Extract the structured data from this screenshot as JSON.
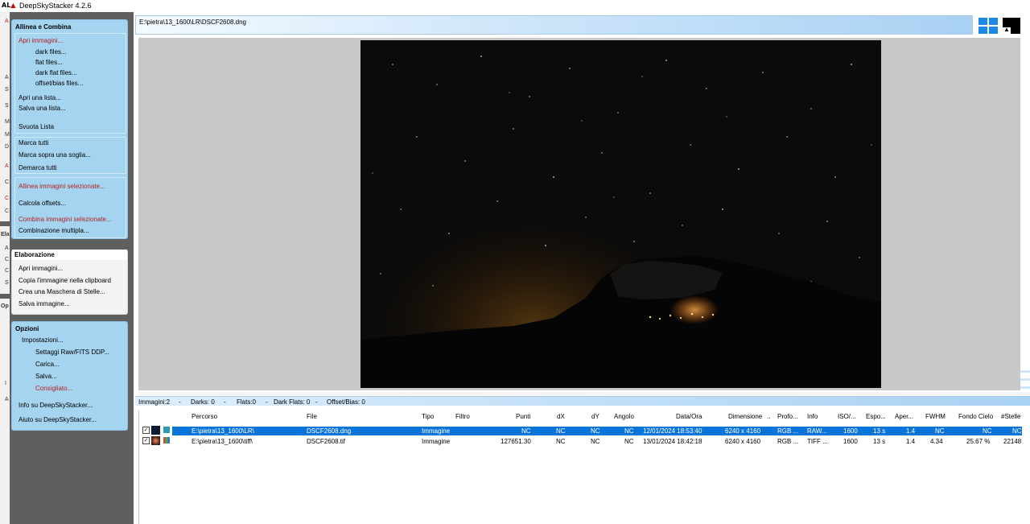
{
  "window": {
    "title": "DeepSkyStacker 4.2.6",
    "icon_text": "AL"
  },
  "left_strip": {
    "letters": [
      "A",
      "S",
      "A",
      "S",
      "S",
      "M",
      "M",
      "D",
      "A",
      "C",
      "C",
      "C",
      "Ela",
      "A",
      "C",
      "C",
      "S",
      "Op",
      "I",
      "A"
    ]
  },
  "panels": {
    "allinea": {
      "title": "Allinea e Combina",
      "group1": [
        "Apri immagini...",
        "dark files...",
        "flat files...",
        "dark flat files...",
        "offset/bias files...",
        "Apri una lista...",
        "Salva una lista...",
        "Svuota Lista"
      ],
      "group2": [
        "Marca tutti",
        "Marca sopra una soglia...",
        "Demarca tutti"
      ],
      "group3": [
        "Allinea immagini selezionate...",
        "Calcola offsets...",
        "Combina immagini selezionate...",
        "Combinazione multipla..."
      ]
    },
    "elaborazione": {
      "title": "Elaborazione",
      "items": [
        "Apri immagini...",
        "Copia l'immagine nella clipboard",
        "Crea una Maschera di Stelle...",
        "Salva immagine..."
      ]
    },
    "opzioni": {
      "title": "Opzioni",
      "items": [
        "Impostazioni...",
        "Settaggi Raw/FITS DDP...",
        "Carica...",
        "Salva...",
        "Consigliato...",
        "Info su DeepSkyStacker...",
        "Aiuto su DeepSkyStacker..."
      ]
    }
  },
  "path_bar": {
    "path": "E:\\pietra\\13_1600\\LR\\DSCF2608.dng"
  },
  "status": {
    "immagini": "Immagini:2",
    "sep": "-",
    "darks": "Darks: 0",
    "flats": "Flats:0",
    "dark_flats": "Dark Flats: 0",
    "offset": "Offset/Bias: 0"
  },
  "table": {
    "headers": [
      "Percorso",
      "File",
      "Tipo",
      "Filtro",
      "Punti",
      "dX",
      "dY",
      "Angolo",
      "Data/Ora",
      "Dimensione",
      "..",
      "Profo...",
      "Info",
      "ISO/...",
      "Espo...",
      "Aper...",
      "FWHM",
      "Fondo Cielo",
      "#Stelle"
    ],
    "rows": [
      [
        "E:\\pietra\\13_1600\\LR\\",
        "DSCF2608.dng",
        "Immagine",
        "",
        "NC",
        "NC",
        "NC",
        "NC",
        "12/01/2024 18:53:40",
        "6240 x 4160",
        "",
        "RGB ...",
        "RAW...",
        "1600",
        "13 s",
        "1.4",
        "NC",
        "NC",
        "NC"
      ],
      [
        "E:\\pietra\\13_1600\\tiff\\",
        "DSCF2608.tif",
        "Immagine",
        "",
        "127651.30",
        "NC",
        "NC",
        "NC",
        "13/01/2024 18:42:18",
        "6240 x 4160",
        "",
        "RGB ...",
        "TIFF ...",
        "1600",
        "13 s",
        "1.4",
        "4.34",
        "25.67 %",
        "22148"
      ]
    ],
    "checkmark": "✓"
  },
  "colors": {
    "panel": "#a5d4f0",
    "accent_text": "#b22222",
    "selection": "#0a74d9"
  }
}
